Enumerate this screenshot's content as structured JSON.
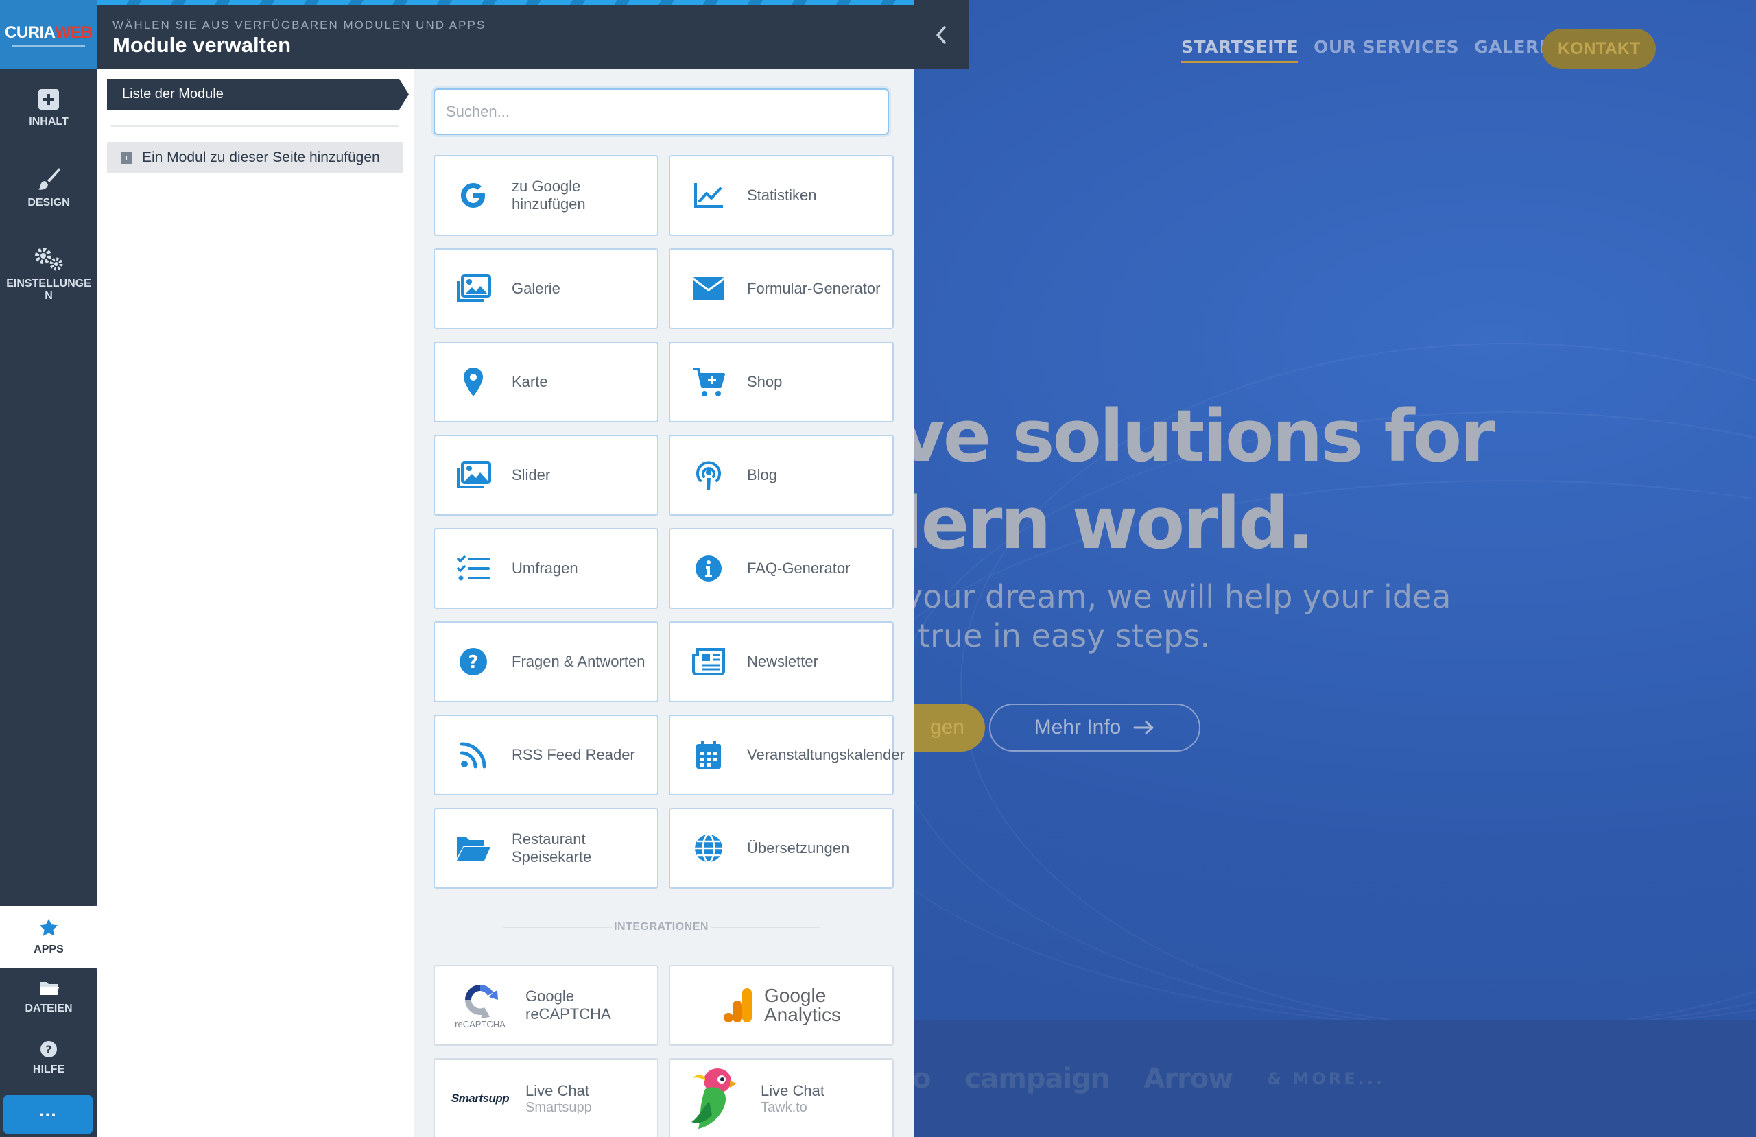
{
  "window": {
    "kicker": "WÄHLEN SIE AUS VERFÜGBAREN MODULEN UND APPS",
    "title": "Module verwalten"
  },
  "logo": {
    "text_a": "CURIA",
    "text_b": "WEB"
  },
  "sidebar": {
    "items": [
      {
        "label": "INHALT",
        "icon": "plus-square-icon"
      },
      {
        "label": "DESIGN",
        "icon": "brush-icon"
      },
      {
        "label": "EINSTELLUNGEN",
        "icon": "gears-icon"
      }
    ],
    "apps": {
      "label": "APPS",
      "icon": "star-icon"
    },
    "bottom": [
      {
        "label": "DATEIEN",
        "icon": "folder-icon"
      },
      {
        "label": "HILFE",
        "icon": "question-icon"
      }
    ],
    "more": "···"
  },
  "list": {
    "tab_label": "Liste der Module",
    "add_label": "Ein Modul zu dieser Seite hinzufügen"
  },
  "search": {
    "placeholder": "Suchen..."
  },
  "modules": [
    {
      "label": "zu Google hinzufügen",
      "icon": "google-icon"
    },
    {
      "label": "Statistiken",
      "icon": "line-chart-icon"
    },
    {
      "label": "Galerie",
      "icon": "gallery-icon"
    },
    {
      "label": "Formular-Generator",
      "icon": "envelope-icon"
    },
    {
      "label": "Karte",
      "icon": "map-pin-icon"
    },
    {
      "label": "Shop",
      "icon": "cart-icon"
    },
    {
      "label": "Slider",
      "icon": "images-icon"
    },
    {
      "label": "Blog",
      "icon": "podcast-icon"
    },
    {
      "label": "Umfragen",
      "icon": "checklist-icon"
    },
    {
      "label": "FAQ-Generator",
      "icon": "info-icon"
    },
    {
      "label": "Fragen & Antworten",
      "icon": "question-circle-icon"
    },
    {
      "label": "Newsletter",
      "icon": "newspaper-icon"
    },
    {
      "label": "RSS Feed Reader",
      "icon": "rss-icon"
    },
    {
      "label": "Veranstaltungskalender",
      "icon": "calendar-icon"
    },
    {
      "label": "Restaurant Speisekarte",
      "icon": "folder-open-icon"
    },
    {
      "label": "Übersetzungen",
      "icon": "globe-icon"
    }
  ],
  "integrations_heading": "INTEGRATIONEN",
  "integrations": [
    {
      "title": "Google reCAPTCHA",
      "sub": "",
      "logo_caption": "reCAPTCHA",
      "icon": "recaptcha-icon"
    },
    {
      "title": "Google Analytics",
      "sub": "",
      "icon": "analytics-icon"
    },
    {
      "title": "Live Chat",
      "sub": "Smartsupp",
      "logo_text": "Smartsupp",
      "icon": "smartsupp-logo"
    },
    {
      "title": "Live Chat",
      "sub": "Tawk.to",
      "icon": "tawk-parrot-icon"
    }
  ],
  "site": {
    "nav": [
      "STARTSEITE",
      "OUR SERVICES",
      "GALERIE"
    ],
    "contact": "KONTAKT",
    "hero_line1": "ve solutions for",
    "hero_line2": "lern world.",
    "hero_sub1": "your dream, we will help your idea",
    "hero_sub2": "true in easy steps.",
    "btn_primary": "gen",
    "btn_more": "Mehr Info",
    "logos": [
      "o",
      "campaign",
      "Arrow",
      "& MORE..."
    ]
  },
  "colors": {
    "accent": "#1e8ad6",
    "dark": "#2c3a4b",
    "icon_blue": "#1e8ad6"
  }
}
